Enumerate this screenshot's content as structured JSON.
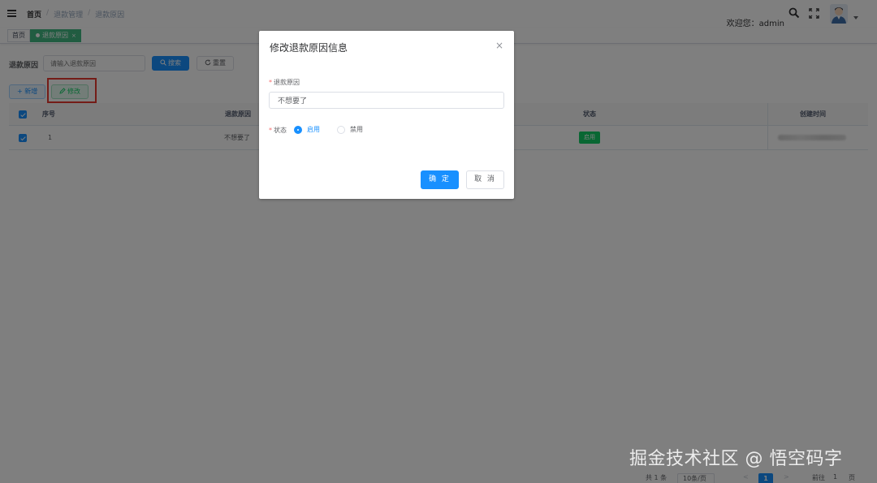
{
  "header": {
    "breadcrumb": [
      "首页",
      "退款管理",
      "退款原因"
    ],
    "breadcrumb_sep": "/",
    "welcome": "欢迎您：admin"
  },
  "tags": {
    "home": "首页",
    "active": "退款原因",
    "active_close": "×"
  },
  "search": {
    "label": "退款原因",
    "placeholder": "请输入退款原因",
    "search_button": "搜索",
    "reset_button": "重置"
  },
  "toolbar": {
    "add_button": "+ 新增",
    "edit_button": "修改"
  },
  "table": {
    "columns": [
      "序号",
      "退款原因",
      "状态",
      "创建时间"
    ],
    "rows": [
      {
        "index": "1",
        "reason": "不想要了",
        "status": "启用"
      }
    ]
  },
  "pagination": {
    "total": "共 1 条",
    "page_size": "10条/页",
    "prev": "<",
    "current": "1",
    "next": ">",
    "goto": "前往",
    "goto_page": "1",
    "page_suffix": "页"
  },
  "dialog": {
    "title": "修改退款原因信息",
    "close": "×",
    "reason_label": "退款原因",
    "reason_value": "不想要了",
    "status_label": "状态",
    "required_mark": "*",
    "status_options": [
      "启用",
      "禁用"
    ],
    "status_selected": "启用",
    "confirm_button": "确 定",
    "cancel_button": "取 消"
  },
  "watermark": "掘金技术社区 @ 悟空码字",
  "colors": {
    "primary": "#1890ff",
    "success": "#13ce66",
    "highlight": "#e8392e",
    "tag_active": "#42b983"
  }
}
